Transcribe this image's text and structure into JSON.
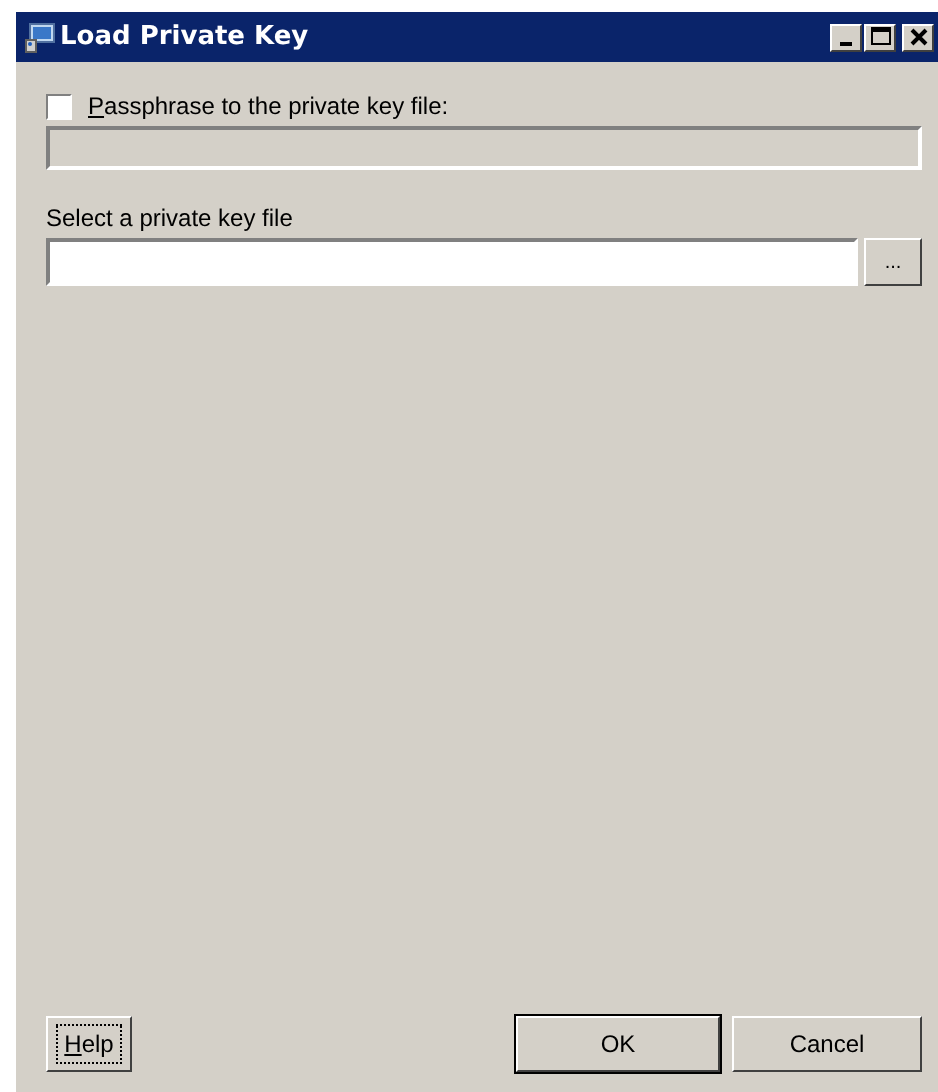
{
  "window": {
    "title": "Load Private Key",
    "controls": [
      {
        "kind": "minimize"
      },
      {
        "kind": "maximize"
      },
      {
        "kind": "close"
      }
    ]
  },
  "passphrase": {
    "checked": false,
    "label": {
      "mnemonic": "P",
      "rest": "assphrase to the private key file:"
    },
    "disabled": true
  },
  "key_file": {
    "label": "Select a private key file",
    "browse": "..."
  },
  "buttons": [
    {
      "mnemonic": "H",
      "rest": "elp",
      "focused": true,
      "default": false
    },
    {
      "rest": "OK",
      "focused": false,
      "default": true
    },
    {
      "rest": "Cancel",
      "focused": false,
      "default": false
    }
  ]
}
